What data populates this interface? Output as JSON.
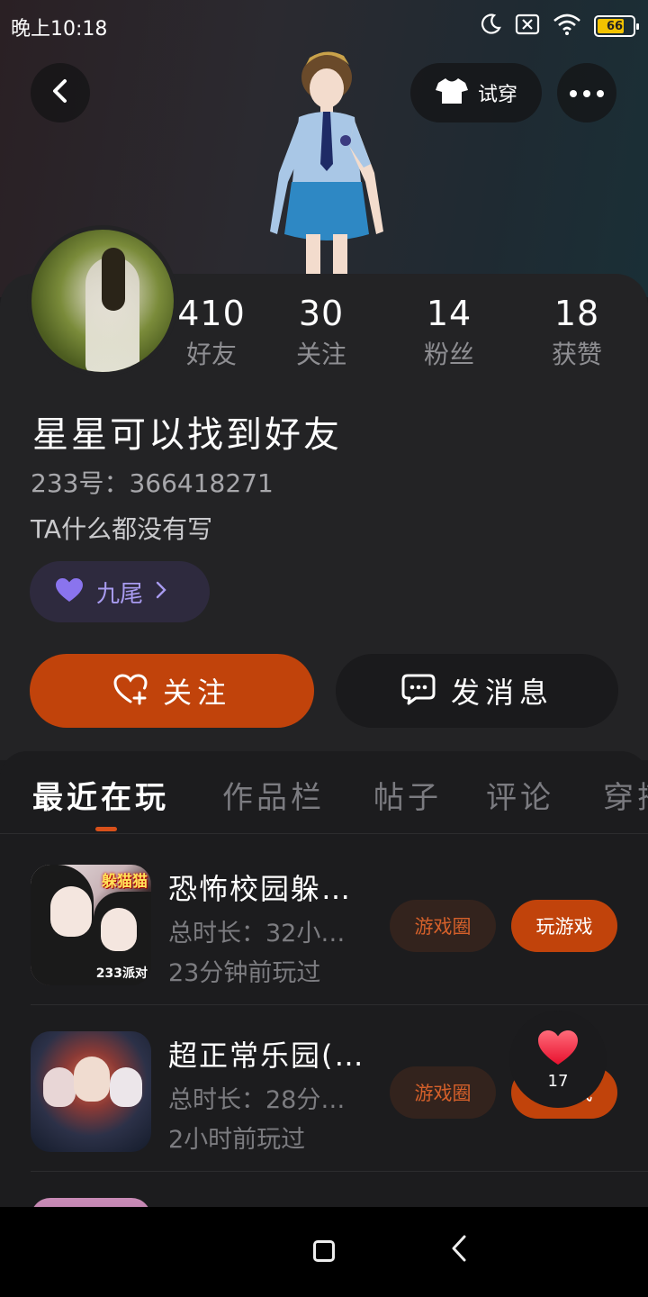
{
  "status_bar": {
    "time": "晚上10:18",
    "battery": "66"
  },
  "header": {
    "try_on_label": "试穿"
  },
  "profile": {
    "stats": [
      {
        "value": "410",
        "label": "好友"
      },
      {
        "value": "30",
        "label": "关注"
      },
      {
        "value": "14",
        "label": "粉丝"
      },
      {
        "value": "18",
        "label": "获赞"
      }
    ],
    "name": "星星可以找到好友",
    "uid": "233号：366418271",
    "bio": "TA什么都没有写",
    "tag_label": "九尾",
    "follow_label": "关注",
    "message_label": "发消息"
  },
  "tabs": [
    {
      "label": "最近在玩"
    },
    {
      "label": "作品栏"
    },
    {
      "label": "帖子"
    },
    {
      "label": "评论"
    },
    {
      "label": "穿搭"
    }
  ],
  "games": [
    {
      "title": "恐怖校园躲…",
      "duration": "总时长：32小…",
      "last_played": "23分钟前玩过",
      "thumb_badge": "躲猫猫",
      "thumb_badge2": "233派对",
      "circle_label": "游戏圈",
      "play_label": "玩游戏"
    },
    {
      "title": "超正常乐园(…",
      "duration": "总时长：28分…",
      "last_played": "2小时前玩过",
      "circle_label": "游戏圈",
      "play_label": "玩游戏"
    }
  ],
  "like_float": {
    "count": "17"
  },
  "colors": {
    "accent": "#c1430b",
    "tag_purple": "#a89bf0",
    "background": "#1c1c1e"
  },
  "icons": [
    "moon-icon",
    "sim-off-icon",
    "wifi-icon",
    "battery-icon",
    "back-arrow-icon",
    "tshirt-icon",
    "more-dots-icon",
    "heart-icon",
    "heart-plus-icon",
    "chat-icon",
    "chevron-right-icon",
    "home-square-icon",
    "nav-back-icon"
  ]
}
